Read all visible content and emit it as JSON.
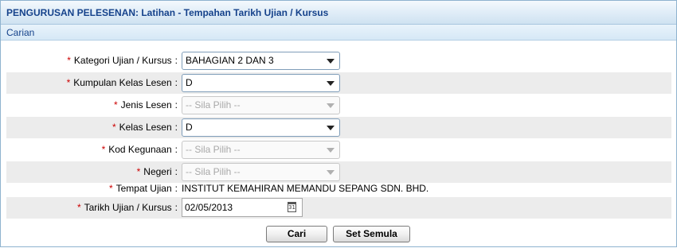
{
  "header": {
    "title": "PENGURUSAN PELESENAN: Latihan - Tempahan Tarikh Ujian / Kursus"
  },
  "section": {
    "title": "Carian"
  },
  "form": {
    "required_mark": "*",
    "colon": ":",
    "kategori": {
      "label": "Kategori Ujian / Kursus",
      "value": "BAHAGIAN 2 DAN 3"
    },
    "kumpulan": {
      "label": "Kumpulan Kelas Lesen",
      "value": "D"
    },
    "jenis": {
      "label": "Jenis Lesen",
      "value": "-- Sila Pilih --"
    },
    "kelas": {
      "label": "Kelas Lesen",
      "value": "D"
    },
    "kod": {
      "label": "Kod Kegunaan",
      "value": "-- Sila Pilih --"
    },
    "negeri": {
      "label": "Negeri",
      "value": "-- Sila Pilih --"
    },
    "tempat": {
      "label": "Tempat Ujian",
      "value": "INSTITUT KEMAHIRAN MEMANDU SEPANG SDN. BHD."
    },
    "tarikh": {
      "label": "Tarikh Ujian / Kursus",
      "value": "02/05/2013",
      "calendar_digits": "31"
    }
  },
  "buttons": {
    "search": "Cari",
    "reset": "Set Semula"
  }
}
